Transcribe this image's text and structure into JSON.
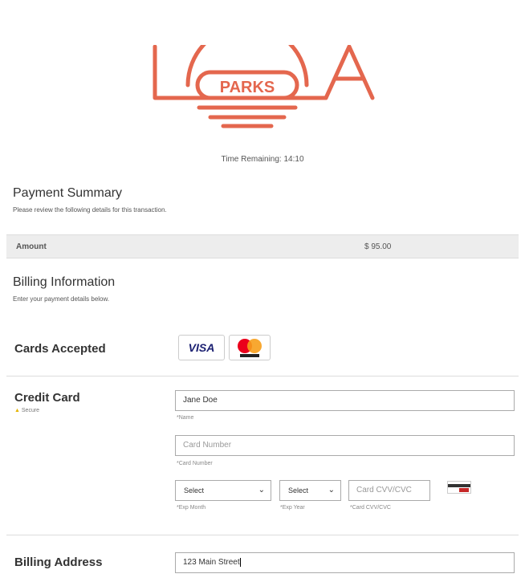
{
  "logo": {
    "text": "PARKS",
    "letters": "L A",
    "color": "#e4674e"
  },
  "timer": {
    "label": "Time Remaining:",
    "value": "14:10"
  },
  "summary": {
    "title": "Payment Summary",
    "subtitle": "Please review the following details for this transaction."
  },
  "amount": {
    "label": "Amount",
    "value": "$  95.00"
  },
  "billing": {
    "title": "Billing Information",
    "subtitle": "Enter your payment details below."
  },
  "cards": {
    "label": "Cards Accepted",
    "visa": "VISA",
    "mastercard": "mastercard"
  },
  "credit_card": {
    "label": "Credit Card",
    "secure": "Secure",
    "name_value": "Jane Doe",
    "name_hint": "*Name",
    "card_number_placeholder": "Card Number",
    "card_number_hint": "*Card Number",
    "exp_month": "Select",
    "exp_month_hint": "*Exp Month",
    "exp_year": "Select",
    "exp_year_hint": "*Exp Year",
    "cvv_placeholder": "Card CVV/CVC",
    "cvv_hint": "*Card CVV/CVC"
  },
  "billing_address": {
    "label": "Billing Address",
    "address_value": "123 Main Street"
  },
  "colors": {
    "accent": "#e4674e",
    "row_bg": "#ededed"
  }
}
